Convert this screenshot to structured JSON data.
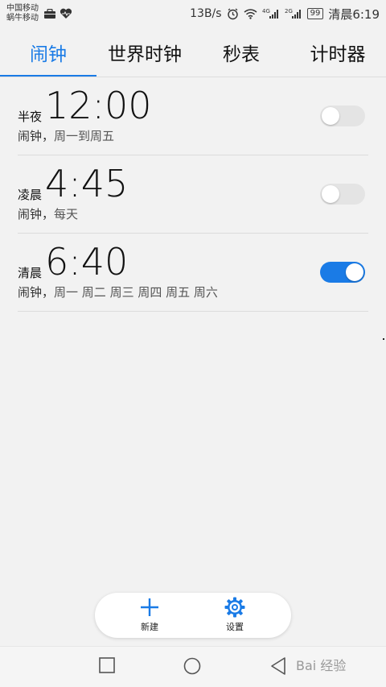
{
  "status_bar": {
    "carrier_1": "中国移动",
    "carrier_2": "蜗牛移动",
    "left_icons": [
      "briefcase-icon",
      "heart-pulse-icon"
    ],
    "speed": "13B/s",
    "net_1": "4G",
    "net_2": "2G",
    "battery": "99",
    "time": "清晨6:19"
  },
  "tabs": [
    {
      "label": "闹钟",
      "active": true
    },
    {
      "label": "世界时钟",
      "active": false
    },
    {
      "label": "秒表",
      "active": false
    },
    {
      "label": "计时器",
      "active": false
    }
  ],
  "alarms": [
    {
      "period": "半夜",
      "time": "12:00",
      "label": "闹钟",
      "sep": "，",
      "days": "周一到周五",
      "enabled": false
    },
    {
      "period": "凌晨",
      "time": "4:45",
      "label": "闹钟",
      "sep": "，",
      "days": "每天",
      "enabled": false
    },
    {
      "period": "清晨",
      "time": "6:40",
      "label": "闹钟",
      "sep": "，",
      "days": "周一 周二 周三 周四 周五 周六",
      "enabled": true
    }
  ],
  "actions": {
    "new_label": "新建",
    "settings_label": "设置"
  },
  "watermark": "Bai 经验",
  "colors": {
    "accent": "#1a7be6",
    "toggle_off": "#e4e4e4",
    "background": "#f2f2f2"
  }
}
